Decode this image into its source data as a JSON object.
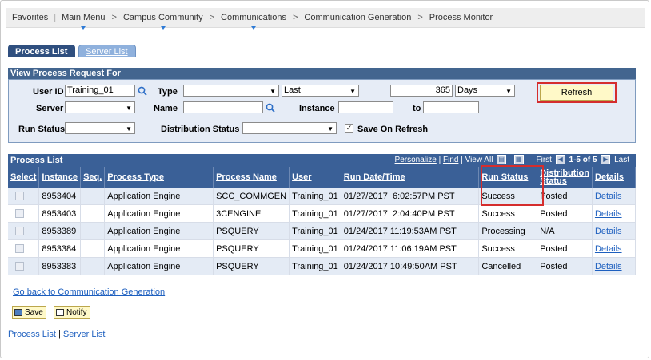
{
  "breadcrumb": {
    "favorites": "Favorites",
    "main_menu": "Main Menu",
    "campus_community": "Campus Community",
    "communications": "Communications",
    "communication_generation": "Communication Generation",
    "process_monitor": "Process Monitor"
  },
  "tabs": {
    "process_list": "Process List",
    "server_list": "Server List"
  },
  "request": {
    "header": "View Process Request For",
    "user_id_label": "User ID",
    "user_id_value": "Training_01",
    "type_label": "Type",
    "type_value": "",
    "last_value": "Last",
    "last_count": "365",
    "unit_value": "Days",
    "refresh_label": "Refresh",
    "server_label": "Server",
    "server_value": "",
    "name_label": "Name",
    "name_value": "",
    "instance_label": "Instance",
    "instance_value": "",
    "to_label": "to",
    "to_value": "",
    "run_status_label": "Run Status",
    "run_status_value": "",
    "distribution_status_label": "Distribution Status",
    "distribution_status_value": "",
    "save_on_refresh_label": "Save On Refresh",
    "save_on_refresh_checked": true
  },
  "grid": {
    "title": "Process List",
    "personalize": "Personalize",
    "find": "Find",
    "view_all": "View All",
    "first": "First",
    "range": "1-5 of 5",
    "last": "Last",
    "columns": [
      "Select",
      "Instance",
      "Seq.",
      "Process Type",
      "Process Name",
      "User",
      "Run Date/Time",
      "Run Status",
      "Distribution Status",
      "Details"
    ],
    "rows": [
      {
        "instance": "8953404",
        "seq": "",
        "process_type": "Application Engine",
        "process_name": "SCC_COMMGEN",
        "user": "Training_01",
        "run_datetime": "01/27/2017  6:02:57PM PST",
        "run_status": "Success",
        "distribution_status": "Posted",
        "details": "Details"
      },
      {
        "instance": "8953403",
        "seq": "",
        "process_type": "Application Engine",
        "process_name": "3CENGINE",
        "user": "Training_01",
        "run_datetime": "01/27/2017  2:04:40PM PST",
        "run_status": "Success",
        "distribution_status": "Posted",
        "details": "Details"
      },
      {
        "instance": "8953389",
        "seq": "",
        "process_type": "Application Engine",
        "process_name": "PSQUERY",
        "user": "Training_01",
        "run_datetime": "01/24/2017 11:19:53AM PST",
        "run_status": "Processing",
        "distribution_status": "N/A",
        "details": "Details"
      },
      {
        "instance": "8953384",
        "seq": "",
        "process_type": "Application Engine",
        "process_name": "PSQUERY",
        "user": "Training_01",
        "run_datetime": "01/24/2017 11:06:19AM PST",
        "run_status": "Success",
        "distribution_status": "Posted",
        "details": "Details"
      },
      {
        "instance": "8953383",
        "seq": "",
        "process_type": "Application Engine",
        "process_name": "PSQUERY",
        "user": "Training_01",
        "run_datetime": "01/24/2017 10:49:50AM PST",
        "run_status": "Cancelled",
        "distribution_status": "Posted",
        "details": "Details"
      }
    ]
  },
  "links": {
    "go_back": "Go back to Communication Generation",
    "save": "Save",
    "notify": "Notify",
    "footer_process_list": "Process List",
    "footer_server_list": "Server List"
  },
  "colors": {
    "header_blue": "#43658f",
    "highlight_red": "#d52d2d",
    "button_yellow": "#fff9c8",
    "link_blue": "#1d5fbf"
  }
}
